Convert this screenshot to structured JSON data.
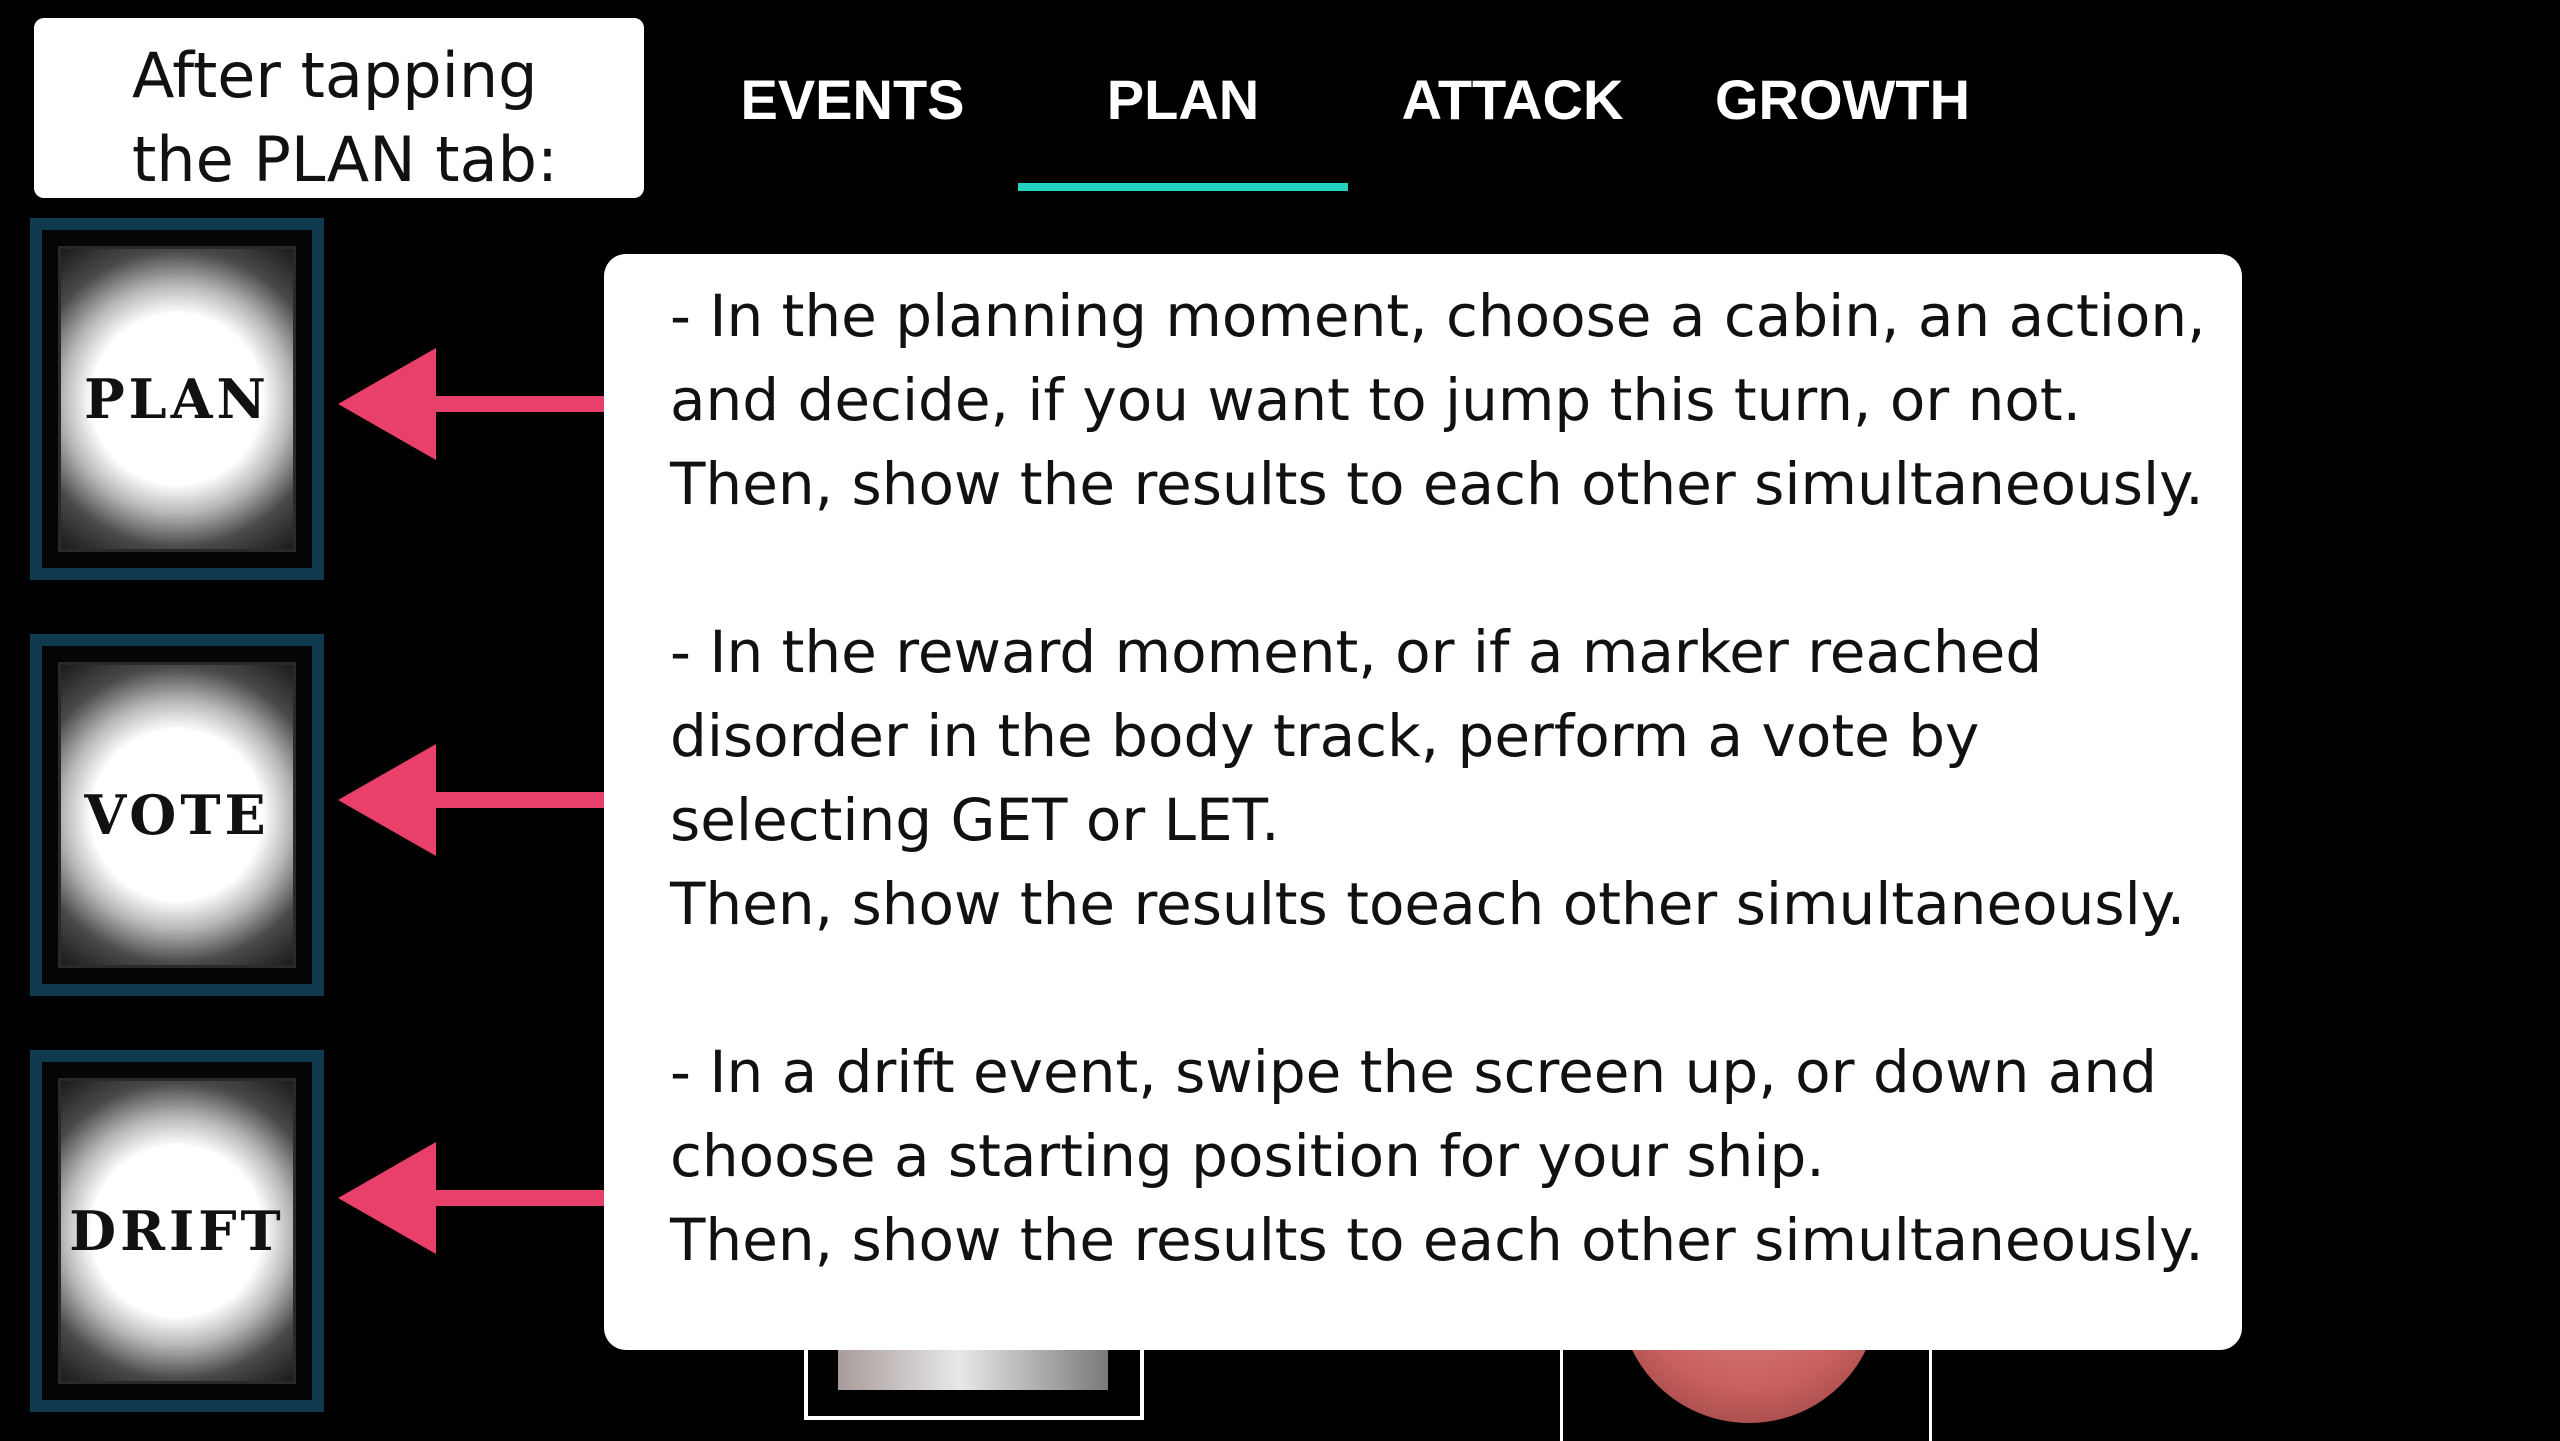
{
  "callout": {
    "line1": "After tapping",
    "line2": "the PLAN tab:"
  },
  "tabs": [
    {
      "label": "EVENTS",
      "selected": false
    },
    {
      "label": "PLAN",
      "selected": true
    },
    {
      "label": "ATTACK",
      "selected": false
    },
    {
      "label": "GROWTH",
      "selected": false
    }
  ],
  "accent_color": "#22d3c2",
  "arrow_color": "#e8406a",
  "cards": [
    {
      "label": "PLAN"
    },
    {
      "label": "VOTE"
    },
    {
      "label": "DRIFT"
    }
  ],
  "panel": {
    "paragraphs": [
      {
        "lines": [
          "- In the planning moment, choose a cabin, an action,",
          "and decide, if you want to jump this turn, or not.",
          "Then, show the results to each other simultaneously."
        ]
      },
      {
        "lines": [
          "- In the reward moment, or if a marker reached",
          "disorder in the body track, perform a vote by",
          "selecting GET or LET.",
          "Then, show the results toeach other simultaneously."
        ]
      },
      {
        "lines": [
          "- In a drift event, swipe the screen up, or down and",
          "choose a starting position for your ship.",
          "Then, show the results to each other simultaneously."
        ]
      }
    ]
  }
}
